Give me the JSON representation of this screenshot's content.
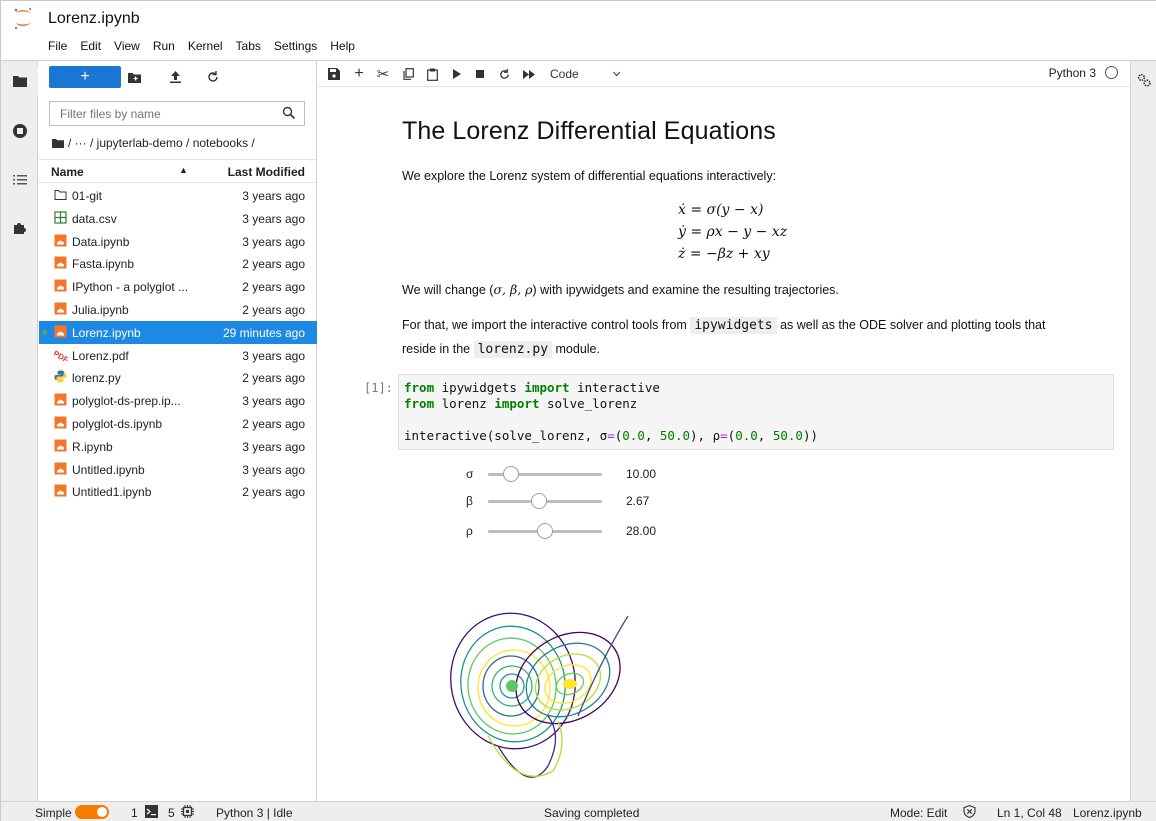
{
  "window": {
    "title": "Lorenz.ipynb"
  },
  "menu": [
    "File",
    "Edit",
    "View",
    "Run",
    "Kernel",
    "Tabs",
    "Settings",
    "Help"
  ],
  "filebrowser": {
    "new_label": "+",
    "search_placeholder": "Filter files by name",
    "breadcrumb": "/ ··· / jupyterlab-demo / notebooks /",
    "col_name": "Name",
    "col_modified": "Last Modified",
    "files": [
      {
        "name": "01-git",
        "modified": "3 years ago",
        "icon": "folder-icon"
      },
      {
        "name": "data.csv",
        "modified": "3 years ago",
        "icon": "spreadsheet-icon"
      },
      {
        "name": "Data.ipynb",
        "modified": "3 years ago",
        "icon": "notebook-icon"
      },
      {
        "name": "Fasta.ipynb",
        "modified": "2 years ago",
        "icon": "notebook-icon"
      },
      {
        "name": "IPython - a polyglot ...",
        "modified": "2 years ago",
        "icon": "notebook-icon"
      },
      {
        "name": "Julia.ipynb",
        "modified": "2 years ago",
        "icon": "notebook-icon"
      },
      {
        "name": "Lorenz.ipynb",
        "modified": "29 minutes ago",
        "icon": "notebook-icon",
        "selected": true
      },
      {
        "name": "Lorenz.pdf",
        "modified": "3 years ago",
        "icon": "pdf-icon"
      },
      {
        "name": "lorenz.py",
        "modified": "2 years ago",
        "icon": "python-icon"
      },
      {
        "name": "polyglot-ds-prep.ip...",
        "modified": "3 years ago",
        "icon": "notebook-icon"
      },
      {
        "name": "polyglot-ds.ipynb",
        "modified": "2 years ago",
        "icon": "notebook-icon"
      },
      {
        "name": "R.ipynb",
        "modified": "3 years ago",
        "icon": "notebook-icon"
      },
      {
        "name": "Untitled.ipynb",
        "modified": "3 years ago",
        "icon": "notebook-icon"
      },
      {
        "name": "Untitled1.ipynb",
        "modified": "2 years ago",
        "icon": "notebook-icon"
      }
    ]
  },
  "toolbar": {
    "cell_type": "Code",
    "kernel": "Python 3"
  },
  "notebook": {
    "heading": "The Lorenz Differential Equations",
    "intro": "We explore the Lorenz system of differential equations interactively:",
    "eq1": "ẋ = σ(y − x)",
    "eq2": "ẏ = ρx − y − xz",
    "eq3": "ż = −βz + xy",
    "change_pre": "We will change (",
    "change_params": "σ, β, ρ",
    "change_post": ") with ipywidgets and examine the resulting trajectories.",
    "import_pre": "For that, we import the interactive control tools from ",
    "import_code1": "ipywidgets",
    "import_mid": " as well as the ODE solver and plotting tools that",
    "import_pre2": "reside in the ",
    "import_code2": "lorenz.py",
    "import_post2": " module.",
    "prompt": "[1]:",
    "sliders": [
      {
        "label": "σ",
        "value": "10.00",
        "fraction": 0.2
      },
      {
        "label": "β",
        "value": "2.67",
        "fraction": 0.45
      },
      {
        "label": "ρ",
        "value": "28.00",
        "fraction": 0.5
      }
    ]
  },
  "status": {
    "mode_label": "Simple",
    "terminals": "1",
    "kernels": "5",
    "kernel_status": "Python 3 | Idle",
    "message": "Saving completed",
    "edit_mode": "Mode: Edit",
    "cursor": "Ln 1, Col 48",
    "filename": "Lorenz.ipynb"
  },
  "colors": {
    "accent": "#1e88e5",
    "toggle": "#f57c00",
    "keyword": "#008000"
  }
}
